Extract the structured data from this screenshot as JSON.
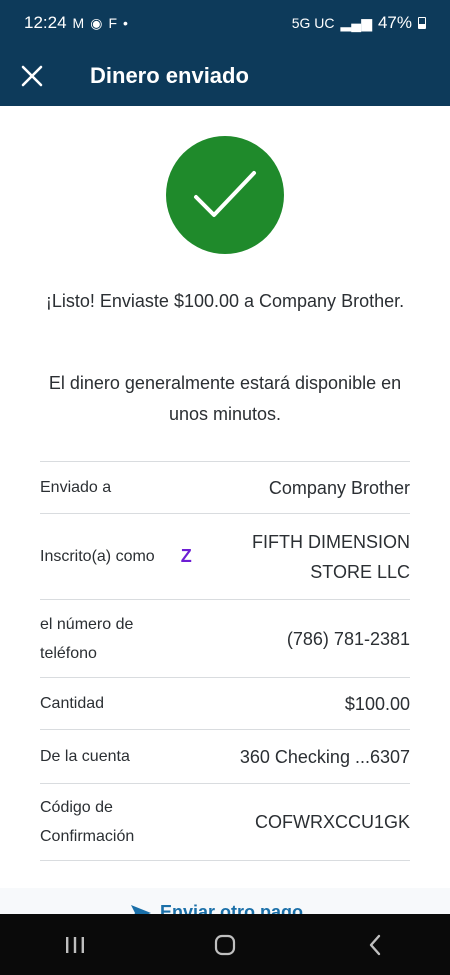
{
  "status": {
    "time": "12:24",
    "network": "5G UC",
    "battery": "47%"
  },
  "appbar": {
    "title": "Dinero enviado",
    "close_icon": "close-icon"
  },
  "confirmation": {
    "message": "¡Listo! Enviaste $100.00 a Company Brother.",
    "availability": "El dinero generalmente estará disponible en unos minutos."
  },
  "details": {
    "rows": [
      {
        "label": "Enviado a",
        "value": "Company Brother"
      },
      {
        "label": "Inscrito(a) como",
        "value": "FIFTH DIMENSION STORE LLC",
        "badge": "Z"
      },
      {
        "label": "el número de teléfono",
        "value": "(786) 781-2381"
      },
      {
        "label": "Cantidad",
        "value": "$100.00"
      },
      {
        "label": "De la cuenta",
        "value": "360 Checking ...6307"
      },
      {
        "label": "Código de Confirmación",
        "value": "COFWRXCCU1GK"
      }
    ]
  },
  "actions": {
    "send_again": "Enviar otro pago"
  },
  "colors": {
    "header_bg": "#0d3a5a",
    "success_green": "#1f8a2b",
    "zelle_purple": "#6d1ed4",
    "link_blue": "#1a6fa8"
  }
}
